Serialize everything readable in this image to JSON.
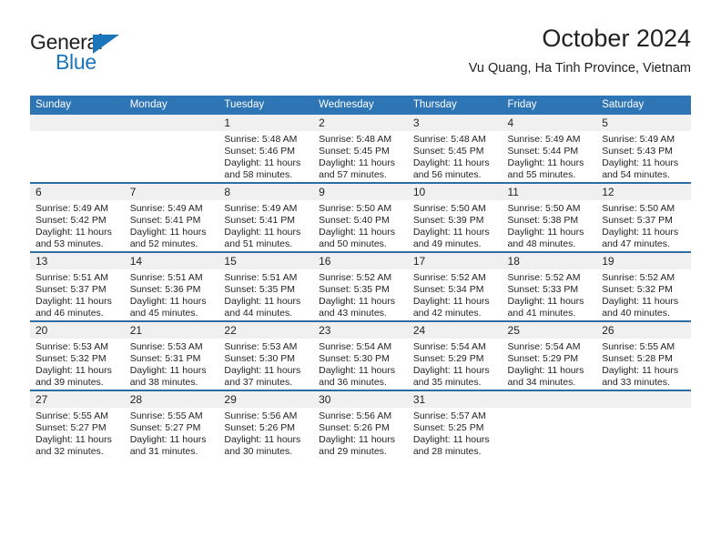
{
  "brand": {
    "name_part1": "General",
    "name_part2": "Blue",
    "triangle_icon": "triangle-right-icon",
    "accent_color": "#1b75bb"
  },
  "header": {
    "title": "October 2024",
    "subtitle": "Vu Quang, Ha Tinh Province, Vietnam"
  },
  "calendar": {
    "header_color": "#2e75b6",
    "row_divider_color": "#2e6da4",
    "daynum_band_color": "#f0f0f0",
    "weekdays": [
      "Sunday",
      "Monday",
      "Tuesday",
      "Wednesday",
      "Thursday",
      "Friday",
      "Saturday"
    ],
    "weeks": [
      [
        {
          "day": "",
          "sunrise": "",
          "sunset": "",
          "daylight1": "",
          "daylight2": ""
        },
        {
          "day": "",
          "sunrise": "",
          "sunset": "",
          "daylight1": "",
          "daylight2": ""
        },
        {
          "day": "1",
          "sunrise": "Sunrise: 5:48 AM",
          "sunset": "Sunset: 5:46 PM",
          "daylight1": "Daylight: 11 hours",
          "daylight2": "and 58 minutes."
        },
        {
          "day": "2",
          "sunrise": "Sunrise: 5:48 AM",
          "sunset": "Sunset: 5:45 PM",
          "daylight1": "Daylight: 11 hours",
          "daylight2": "and 57 minutes."
        },
        {
          "day": "3",
          "sunrise": "Sunrise: 5:48 AM",
          "sunset": "Sunset: 5:45 PM",
          "daylight1": "Daylight: 11 hours",
          "daylight2": "and 56 minutes."
        },
        {
          "day": "4",
          "sunrise": "Sunrise: 5:49 AM",
          "sunset": "Sunset: 5:44 PM",
          "daylight1": "Daylight: 11 hours",
          "daylight2": "and 55 minutes."
        },
        {
          "day": "5",
          "sunrise": "Sunrise: 5:49 AM",
          "sunset": "Sunset: 5:43 PM",
          "daylight1": "Daylight: 11 hours",
          "daylight2": "and 54 minutes."
        }
      ],
      [
        {
          "day": "6",
          "sunrise": "Sunrise: 5:49 AM",
          "sunset": "Sunset: 5:42 PM",
          "daylight1": "Daylight: 11 hours",
          "daylight2": "and 53 minutes."
        },
        {
          "day": "7",
          "sunrise": "Sunrise: 5:49 AM",
          "sunset": "Sunset: 5:41 PM",
          "daylight1": "Daylight: 11 hours",
          "daylight2": "and 52 minutes."
        },
        {
          "day": "8",
          "sunrise": "Sunrise: 5:49 AM",
          "sunset": "Sunset: 5:41 PM",
          "daylight1": "Daylight: 11 hours",
          "daylight2": "and 51 minutes."
        },
        {
          "day": "9",
          "sunrise": "Sunrise: 5:50 AM",
          "sunset": "Sunset: 5:40 PM",
          "daylight1": "Daylight: 11 hours",
          "daylight2": "and 50 minutes."
        },
        {
          "day": "10",
          "sunrise": "Sunrise: 5:50 AM",
          "sunset": "Sunset: 5:39 PM",
          "daylight1": "Daylight: 11 hours",
          "daylight2": "and 49 minutes."
        },
        {
          "day": "11",
          "sunrise": "Sunrise: 5:50 AM",
          "sunset": "Sunset: 5:38 PM",
          "daylight1": "Daylight: 11 hours",
          "daylight2": "and 48 minutes."
        },
        {
          "day": "12",
          "sunrise": "Sunrise: 5:50 AM",
          "sunset": "Sunset: 5:37 PM",
          "daylight1": "Daylight: 11 hours",
          "daylight2": "and 47 minutes."
        }
      ],
      [
        {
          "day": "13",
          "sunrise": "Sunrise: 5:51 AM",
          "sunset": "Sunset: 5:37 PM",
          "daylight1": "Daylight: 11 hours",
          "daylight2": "and 46 minutes."
        },
        {
          "day": "14",
          "sunrise": "Sunrise: 5:51 AM",
          "sunset": "Sunset: 5:36 PM",
          "daylight1": "Daylight: 11 hours",
          "daylight2": "and 45 minutes."
        },
        {
          "day": "15",
          "sunrise": "Sunrise: 5:51 AM",
          "sunset": "Sunset: 5:35 PM",
          "daylight1": "Daylight: 11 hours",
          "daylight2": "and 44 minutes."
        },
        {
          "day": "16",
          "sunrise": "Sunrise: 5:52 AM",
          "sunset": "Sunset: 5:35 PM",
          "daylight1": "Daylight: 11 hours",
          "daylight2": "and 43 minutes."
        },
        {
          "day": "17",
          "sunrise": "Sunrise: 5:52 AM",
          "sunset": "Sunset: 5:34 PM",
          "daylight1": "Daylight: 11 hours",
          "daylight2": "and 42 minutes."
        },
        {
          "day": "18",
          "sunrise": "Sunrise: 5:52 AM",
          "sunset": "Sunset: 5:33 PM",
          "daylight1": "Daylight: 11 hours",
          "daylight2": "and 41 minutes."
        },
        {
          "day": "19",
          "sunrise": "Sunrise: 5:52 AM",
          "sunset": "Sunset: 5:32 PM",
          "daylight1": "Daylight: 11 hours",
          "daylight2": "and 40 minutes."
        }
      ],
      [
        {
          "day": "20",
          "sunrise": "Sunrise: 5:53 AM",
          "sunset": "Sunset: 5:32 PM",
          "daylight1": "Daylight: 11 hours",
          "daylight2": "and 39 minutes."
        },
        {
          "day": "21",
          "sunrise": "Sunrise: 5:53 AM",
          "sunset": "Sunset: 5:31 PM",
          "daylight1": "Daylight: 11 hours",
          "daylight2": "and 38 minutes."
        },
        {
          "day": "22",
          "sunrise": "Sunrise: 5:53 AM",
          "sunset": "Sunset: 5:30 PM",
          "daylight1": "Daylight: 11 hours",
          "daylight2": "and 37 minutes."
        },
        {
          "day": "23",
          "sunrise": "Sunrise: 5:54 AM",
          "sunset": "Sunset: 5:30 PM",
          "daylight1": "Daylight: 11 hours",
          "daylight2": "and 36 minutes."
        },
        {
          "day": "24",
          "sunrise": "Sunrise: 5:54 AM",
          "sunset": "Sunset: 5:29 PM",
          "daylight1": "Daylight: 11 hours",
          "daylight2": "and 35 minutes."
        },
        {
          "day": "25",
          "sunrise": "Sunrise: 5:54 AM",
          "sunset": "Sunset: 5:29 PM",
          "daylight1": "Daylight: 11 hours",
          "daylight2": "and 34 minutes."
        },
        {
          "day": "26",
          "sunrise": "Sunrise: 5:55 AM",
          "sunset": "Sunset: 5:28 PM",
          "daylight1": "Daylight: 11 hours",
          "daylight2": "and 33 minutes."
        }
      ],
      [
        {
          "day": "27",
          "sunrise": "Sunrise: 5:55 AM",
          "sunset": "Sunset: 5:27 PM",
          "daylight1": "Daylight: 11 hours",
          "daylight2": "and 32 minutes."
        },
        {
          "day": "28",
          "sunrise": "Sunrise: 5:55 AM",
          "sunset": "Sunset: 5:27 PM",
          "daylight1": "Daylight: 11 hours",
          "daylight2": "and 31 minutes."
        },
        {
          "day": "29",
          "sunrise": "Sunrise: 5:56 AM",
          "sunset": "Sunset: 5:26 PM",
          "daylight1": "Daylight: 11 hours",
          "daylight2": "and 30 minutes."
        },
        {
          "day": "30",
          "sunrise": "Sunrise: 5:56 AM",
          "sunset": "Sunset: 5:26 PM",
          "daylight1": "Daylight: 11 hours",
          "daylight2": "and 29 minutes."
        },
        {
          "day": "31",
          "sunrise": "Sunrise: 5:57 AM",
          "sunset": "Sunset: 5:25 PM",
          "daylight1": "Daylight: 11 hours",
          "daylight2": "and 28 minutes."
        },
        {
          "day": "",
          "sunrise": "",
          "sunset": "",
          "daylight1": "",
          "daylight2": ""
        },
        {
          "day": "",
          "sunrise": "",
          "sunset": "",
          "daylight1": "",
          "daylight2": ""
        }
      ]
    ]
  }
}
